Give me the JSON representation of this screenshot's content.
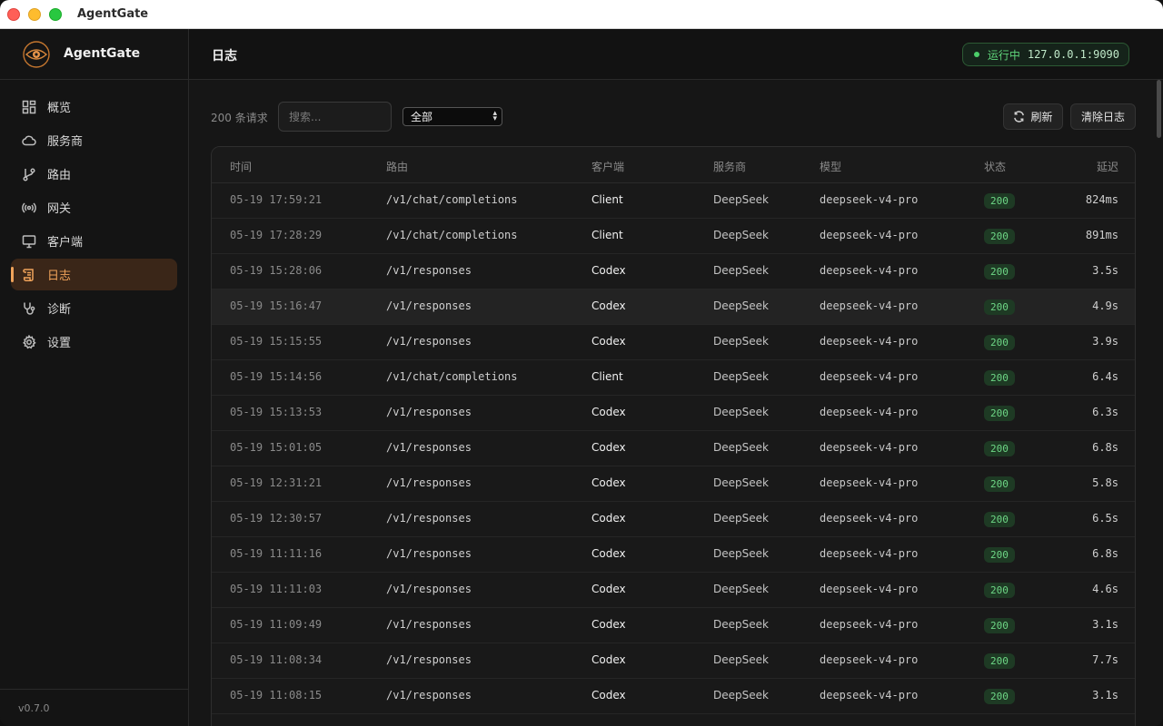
{
  "window": {
    "title": "AgentGate"
  },
  "brand": {
    "name": "AgentGate"
  },
  "nav": [
    {
      "label": "概览",
      "icon": "dashboard-icon",
      "active": false
    },
    {
      "label": "服务商",
      "icon": "cloud-icon",
      "active": false
    },
    {
      "label": "路由",
      "icon": "git-branch-icon",
      "active": false
    },
    {
      "label": "网关",
      "icon": "broadcast-icon",
      "active": false
    },
    {
      "label": "客户端",
      "icon": "monitor-icon",
      "active": false
    },
    {
      "label": "日志",
      "icon": "scroll-icon",
      "active": true
    },
    {
      "label": "诊断",
      "icon": "stethoscope-icon",
      "active": false
    },
    {
      "label": "设置",
      "icon": "gear-icon",
      "active": false
    }
  ],
  "version": "v0.7.0",
  "header": {
    "title": "日志",
    "status_text": "运行中",
    "status_addr": "127.0.0.1:9090"
  },
  "toolbar": {
    "count_text": "200 条请求",
    "search_placeholder": "搜索...",
    "filter_value": "全部",
    "refresh_label": "刷新",
    "clear_label": "清除日志"
  },
  "table": {
    "headers": {
      "time": "时间",
      "route": "路由",
      "client": "客户端",
      "provider": "服务商",
      "model": "模型",
      "status": "状态",
      "latency": "延迟"
    },
    "rows": [
      {
        "time": "05-19 17:59:21",
        "route": "/v1/chat/completions",
        "client": "Client",
        "provider": "DeepSeek",
        "model": "deepseek-v4-pro",
        "status": "200",
        "latency": "824ms"
      },
      {
        "time": "05-19 17:28:29",
        "route": "/v1/chat/completions",
        "client": "Client",
        "provider": "DeepSeek",
        "model": "deepseek-v4-pro",
        "status": "200",
        "latency": "891ms"
      },
      {
        "time": "05-19 15:28:06",
        "route": "/v1/responses",
        "client": "Codex",
        "provider": "DeepSeek",
        "model": "deepseek-v4-pro",
        "status": "200",
        "latency": "3.5s"
      },
      {
        "time": "05-19 15:16:47",
        "route": "/v1/responses",
        "client": "Codex",
        "provider": "DeepSeek",
        "model": "deepseek-v4-pro",
        "status": "200",
        "latency": "4.9s"
      },
      {
        "time": "05-19 15:15:55",
        "route": "/v1/responses",
        "client": "Codex",
        "provider": "DeepSeek",
        "model": "deepseek-v4-pro",
        "status": "200",
        "latency": "3.9s"
      },
      {
        "time": "05-19 15:14:56",
        "route": "/v1/chat/completions",
        "client": "Client",
        "provider": "DeepSeek",
        "model": "deepseek-v4-pro",
        "status": "200",
        "latency": "6.4s"
      },
      {
        "time": "05-19 15:13:53",
        "route": "/v1/responses",
        "client": "Codex",
        "provider": "DeepSeek",
        "model": "deepseek-v4-pro",
        "status": "200",
        "latency": "6.3s"
      },
      {
        "time": "05-19 15:01:05",
        "route": "/v1/responses",
        "client": "Codex",
        "provider": "DeepSeek",
        "model": "deepseek-v4-pro",
        "status": "200",
        "latency": "6.8s"
      },
      {
        "time": "05-19 12:31:21",
        "route": "/v1/responses",
        "client": "Codex",
        "provider": "DeepSeek",
        "model": "deepseek-v4-pro",
        "status": "200",
        "latency": "5.8s"
      },
      {
        "time": "05-19 12:30:57",
        "route": "/v1/responses",
        "client": "Codex",
        "provider": "DeepSeek",
        "model": "deepseek-v4-pro",
        "status": "200",
        "latency": "6.5s"
      },
      {
        "time": "05-19 11:11:16",
        "route": "/v1/responses",
        "client": "Codex",
        "provider": "DeepSeek",
        "model": "deepseek-v4-pro",
        "status": "200",
        "latency": "6.8s"
      },
      {
        "time": "05-19 11:11:03",
        "route": "/v1/responses",
        "client": "Codex",
        "provider": "DeepSeek",
        "model": "deepseek-v4-pro",
        "status": "200",
        "latency": "4.6s"
      },
      {
        "time": "05-19 11:09:49",
        "route": "/v1/responses",
        "client": "Codex",
        "provider": "DeepSeek",
        "model": "deepseek-v4-pro",
        "status": "200",
        "latency": "3.1s"
      },
      {
        "time": "05-19 11:08:34",
        "route": "/v1/responses",
        "client": "Codex",
        "provider": "DeepSeek",
        "model": "deepseek-v4-pro",
        "status": "200",
        "latency": "7.7s"
      },
      {
        "time": "05-19 11:08:15",
        "route": "/v1/responses",
        "client": "Codex",
        "provider": "DeepSeek",
        "model": "deepseek-v4-pro",
        "status": "200",
        "latency": "3.1s"
      }
    ]
  },
  "colors": {
    "accent": "#f0a35a",
    "status_ok": "#5fd37a"
  }
}
